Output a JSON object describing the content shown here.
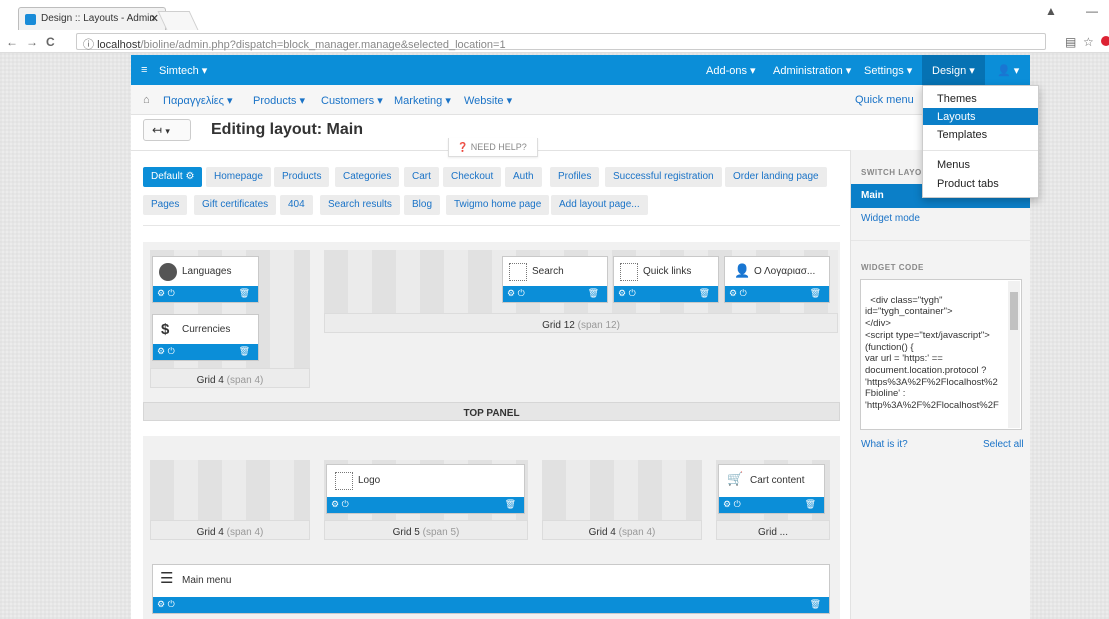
{
  "browser": {
    "tab_title": "Design :: Layouts - Admin",
    "url_host": "localhost",
    "url_path": "/bioline/admin.php?dispatch=block_manager.manage&selected_location=1"
  },
  "topnav": {
    "brand": "Simtech",
    "items": [
      "Add-ons",
      "Administration",
      "Settings",
      "Design"
    ]
  },
  "secnav": {
    "items": [
      "Παραγγελίες",
      "Products",
      "Customers",
      "Marketing",
      "Website"
    ],
    "quick_menu": "Quick menu"
  },
  "dropdown": {
    "items": [
      "Themes",
      "Layouts",
      "Templates",
      "Menus",
      "Product tabs"
    ]
  },
  "page": {
    "title": "Editing layout: Main",
    "need_help": "NEED HELP?"
  },
  "layout_tabs": {
    "row1": [
      "Default",
      "Homepage",
      "Products",
      "Categories",
      "Cart",
      "Checkout",
      "Auth",
      "Profiles",
      "Successful registration",
      "Order landing page"
    ],
    "row2": [
      "Pages",
      "Gift certificates",
      "404",
      "Search results",
      "Blog",
      "Twigmo home page",
      "Add layout page..."
    ]
  },
  "sidebar": {
    "switch_layout": "SWITCH LAYOU",
    "main": "Main",
    "widget_mode": "Widget mode",
    "widget_code": "WIDGET CODE",
    "code": "<div class=\"tygh\"\nid=\"tygh_container\">\n</div>\n<script type=\"text/javascript\">\n(function() {\nvar url = 'https:' ==\ndocument.location.protocol ?\n'https%3A%2F%2Flocalhost%2\nFbioline' :\n'http%3A%2F%2Flocalhost%2F",
    "what_is_it": "What is it?",
    "select_all": "Select all"
  },
  "blocks": {
    "languages": "Languages",
    "currencies": "Currencies",
    "search": "Search",
    "quick_links": "Quick links",
    "account": "Ο Λογαριασ...",
    "logo": "Logo",
    "cart_content": "Cart content",
    "main_menu": "Main menu"
  },
  "grids": {
    "g4a": {
      "name": "Grid 4",
      "span": "(span 4)"
    },
    "g12": {
      "name": "Grid 12",
      "span": "(span 12)"
    },
    "g4b": {
      "name": "Grid 4",
      "span": "(span 4)"
    },
    "g5": {
      "name": "Grid 5",
      "span": "(span 5)"
    },
    "g4c": {
      "name": "Grid 4",
      "span": "(span 4)"
    },
    "gx": {
      "name": "Grid ..."
    }
  },
  "panels": {
    "top": "TOP PANEL"
  },
  "colors": {
    "primary": "#0b8ed8",
    "dark_primary": "#0672b3",
    "link": "#1a73c7"
  }
}
